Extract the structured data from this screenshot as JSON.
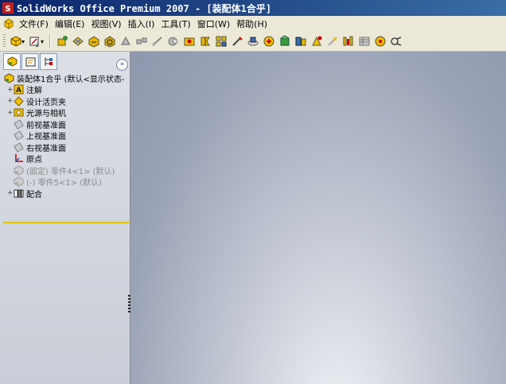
{
  "window": {
    "title": "SolidWorks Office Premium 2007 - [装配体1合乎]"
  },
  "menu": [
    {
      "label": "文件(F)"
    },
    {
      "label": "编辑(E)"
    },
    {
      "label": "视图(V)"
    },
    {
      "label": "插入(I)"
    },
    {
      "label": "工具(T)"
    },
    {
      "label": "窗口(W)"
    },
    {
      "label": "帮助(H)"
    }
  ],
  "toolbar": {
    "icons": [
      "assembly-icon",
      "view-orientation-icon",
      "insert-component-icon",
      "mate-icon",
      "move-component-icon",
      "rotate-component-icon",
      "smart-fasteners-icon",
      "explode-icon",
      "explode-line-icon",
      "interference-icon",
      "hole-series-icon",
      "feature-icon",
      "pattern-icon",
      "assembly-feature-icon",
      "show-hidden-icon",
      "edit-component-icon",
      "new-part-icon",
      "new-assembly-icon",
      "collision-icon",
      "clearance-icon",
      "physical-simulation-icon",
      "bom-icon",
      "design-library-icon",
      "render-icon",
      "isolate-icon"
    ]
  },
  "feature_tree": {
    "root": {
      "label": "装配体1合乎  (默认<显示状态-"
    },
    "items": [
      {
        "label": "注解",
        "icon": "annotations-icon",
        "expandable": true,
        "grey": false
      },
      {
        "label": "设计活页夹",
        "icon": "design-binder-icon",
        "expandable": true,
        "grey": false
      },
      {
        "label": "光源与相机",
        "icon": "lights-cameras-icon",
        "expandable": true,
        "grey": false
      },
      {
        "label": "前视基准面",
        "icon": "plane-icon",
        "expandable": false,
        "grey": false
      },
      {
        "label": "上视基准面",
        "icon": "plane-icon",
        "expandable": false,
        "grey": false
      },
      {
        "label": "右视基准面",
        "icon": "plane-icon",
        "expandable": false,
        "grey": false
      },
      {
        "label": "原点",
        "icon": "origin-icon",
        "expandable": false,
        "grey": false
      },
      {
        "label": "(固定) 零件4<1> (默认)",
        "icon": "part-icon",
        "expandable": false,
        "grey": true
      },
      {
        "label": "(-) 零件5<1> (默认)",
        "icon": "part-icon",
        "expandable": false,
        "grey": true
      },
      {
        "label": "配合",
        "icon": "mates-icon",
        "expandable": true,
        "grey": false
      }
    ]
  },
  "colors": {
    "titlebar_start": "#0a246a",
    "titlebar_end": "#3a6ea5",
    "tree_end_marker": "#e0c000"
  }
}
